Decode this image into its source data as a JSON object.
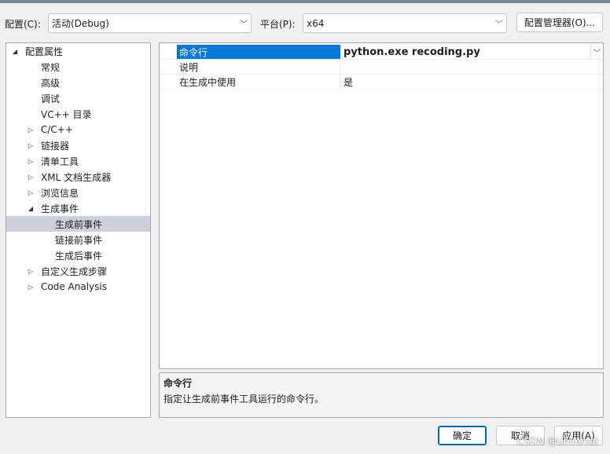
{
  "header": {
    "config_label": "配置(C):",
    "config_value": "活动(Debug)",
    "platform_label": "平台(P):",
    "platform_value": "x64",
    "config_manager_button": "配置管理器(O)..."
  },
  "tree": {
    "items": [
      {
        "label": "配置属性",
        "arrow": "◢",
        "level": 0
      },
      {
        "label": "常规",
        "arrow": "",
        "level": 1
      },
      {
        "label": "高级",
        "arrow": "",
        "level": 1
      },
      {
        "label": "调试",
        "arrow": "",
        "level": 1
      },
      {
        "label": "VC++ 目录",
        "arrow": "",
        "level": 1
      },
      {
        "label": "C/C++",
        "arrow": "▷",
        "level": 1
      },
      {
        "label": "链接器",
        "arrow": "▷",
        "level": 1
      },
      {
        "label": "清单工具",
        "arrow": "▷",
        "level": 1
      },
      {
        "label": "XML 文档生成器",
        "arrow": "▷",
        "level": 1
      },
      {
        "label": "浏览信息",
        "arrow": "▷",
        "level": 1
      },
      {
        "label": "生成事件",
        "arrow": "◢",
        "level": 1
      },
      {
        "label": "生成前事件",
        "arrow": "",
        "level": 2
      },
      {
        "label": "链接前事件",
        "arrow": "",
        "level": 2
      },
      {
        "label": "生成后事件",
        "arrow": "",
        "level": 2
      },
      {
        "label": "自定义生成步骤",
        "arrow": "▷",
        "level": 1
      },
      {
        "label": "Code Analysis",
        "arrow": "▷",
        "level": 1
      }
    ],
    "selected_label": "生成前事件"
  },
  "properties": {
    "rows": [
      {
        "name": "命令行",
        "value": "python.exe recoding.py"
      },
      {
        "name": "说明",
        "value": ""
      },
      {
        "name": "在生成中使用",
        "value": "是"
      }
    ]
  },
  "description": {
    "title": "命令行",
    "text": "指定让生成前事件工具运行的命令行。"
  },
  "footer": {
    "ok": "确定",
    "cancel": "取消",
    "apply": "应用(A)"
  },
  "watermark": "CSDN @Unversal"
}
